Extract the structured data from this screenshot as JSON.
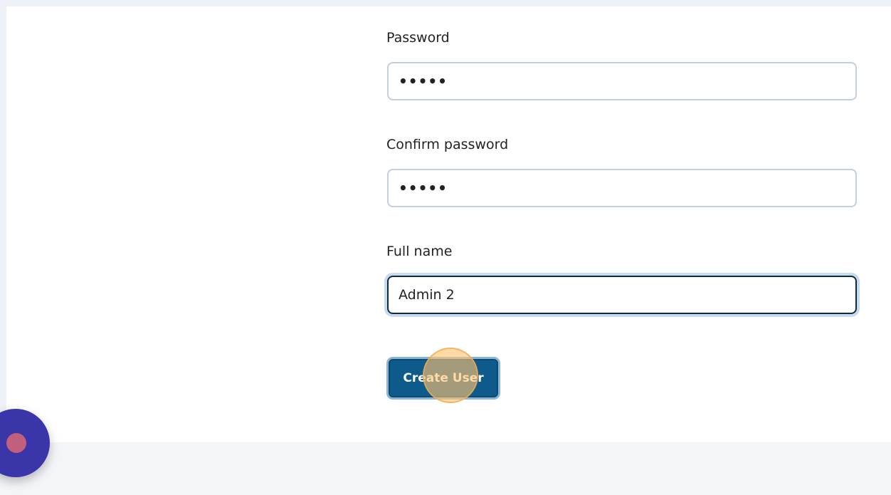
{
  "form": {
    "password": {
      "label": "Password",
      "value": "•••••"
    },
    "confirm_password": {
      "label": "Confirm password",
      "value": "•••••"
    },
    "full_name": {
      "label": "Full name",
      "value": "Admin 2"
    },
    "submit_label": "Create User"
  },
  "colors": {
    "primary_button": "#0e5a8a",
    "focus_border": "#0b2a45",
    "focus_ring": "#c7dbec",
    "page_background": "#eef0f8",
    "fab": "#3a35a8",
    "fab_dot": "#c0607c",
    "click_indicator": "#ffc470"
  },
  "icons": {
    "fab_icon": "chat-bubble-icon"
  }
}
